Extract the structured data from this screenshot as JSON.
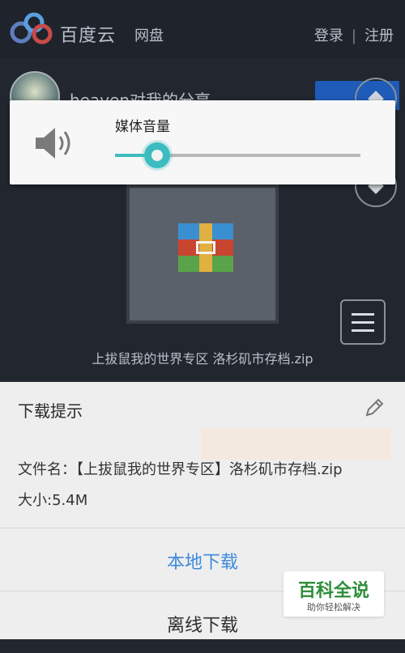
{
  "header": {
    "brand": "百度云",
    "product": "网盘",
    "login": "登录",
    "register": "注册"
  },
  "profile": {
    "username": "heaven对我的分享"
  },
  "file": {
    "name": "上拔鼠我的世界专区 洛杉矶市存档.zip"
  },
  "volume_dialog": {
    "title": "媒体音量",
    "level": 0.17,
    "accent_color": "#3cbcbf"
  },
  "download_sheet": {
    "title": "下载提示",
    "filename_line": "文件名：【上拔鼠我的世界专区】洛杉矶市存档.zip",
    "size_line": "大小:5.4M",
    "options": [
      {
        "label": "本地下载",
        "color": "#3e8ad9"
      },
      {
        "label": "离线下载",
        "color": "#2c2c2c"
      }
    ]
  },
  "watermark": {
    "main": "百科全说",
    "sub": "助你轻松解决"
  },
  "icons": [
    "baidu-cloud-logo",
    "speaker-icon",
    "edit-pencil-icon",
    "menu-icon",
    "diamond-icon"
  ]
}
